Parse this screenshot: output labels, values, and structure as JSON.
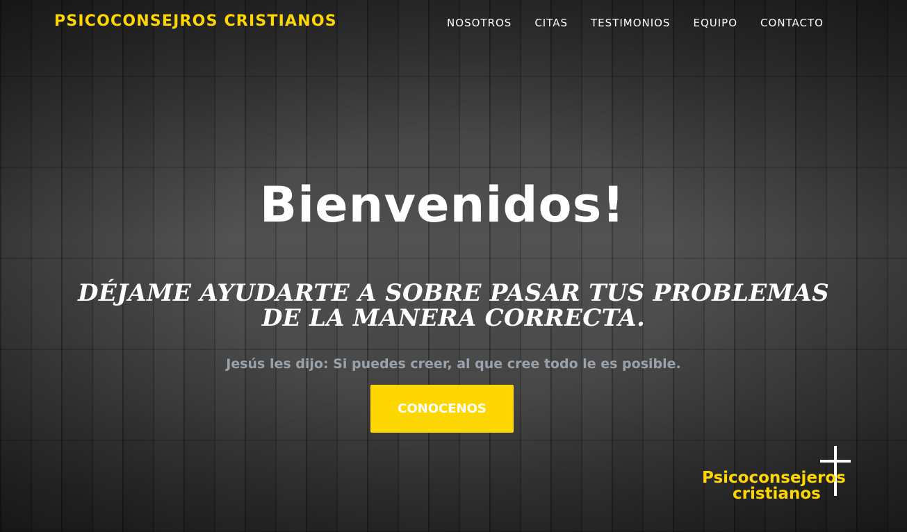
{
  "brand": {
    "name": "PSICOCONSEJROS CRISTIANOS",
    "color": "#ffd700"
  },
  "nav": {
    "items": [
      {
        "label": "NOSOTROS"
      },
      {
        "label": "CITAS"
      },
      {
        "label": "TESTIMONIOS"
      },
      {
        "label": "EQUIPO"
      },
      {
        "label": "CONTACTO"
      }
    ]
  },
  "hero": {
    "title": "Bienvenidos!",
    "subtitle": "DÉJAME AYUDARTE A SOBRE PASAR TUS PROBLEMAS DE LA MANERA CORRECTA.",
    "verse": "Jesús les dijo: Si puedes creer, al que cree todo le es posible.",
    "cta_label": "CONOCENOS"
  },
  "logo": {
    "line1": "Psicoconsejeros",
    "line2": "cristianos",
    "icon": "cross-icon"
  },
  "colors": {
    "accent": "#ffd700",
    "text": "#ffffff",
    "verse": "#9aa3ab"
  }
}
